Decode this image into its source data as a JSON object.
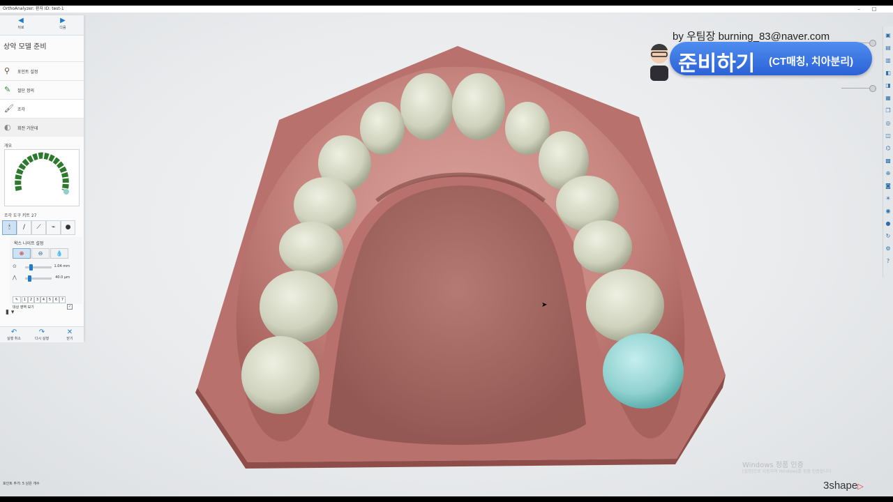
{
  "window": {
    "title": "OrthoAnalyzer: 환자 ID: test-1",
    "minimize": "–",
    "maximize": "□"
  },
  "nav": {
    "prev_label": "뒤로",
    "next_label": "다음"
  },
  "panel": {
    "section_title": "상악 모델 준비",
    "steps": [
      {
        "label": "포인트 설정"
      },
      {
        "label": "절단 정의"
      },
      {
        "label": "조각"
      },
      {
        "label": "회전 가운데"
      }
    ],
    "overview_title": "개요",
    "kit_title": "조각 도구 키트 27",
    "wax_title": "왁스 나이프 설정",
    "wax_size_value": "1.04 mm",
    "wax_angle_value": "40.0 μm",
    "numbers": [
      "1",
      "2",
      "3",
      "4",
      "5",
      "6",
      "7"
    ],
    "show_target_label": "대상 영역 보기",
    "show_target_checked": "✓"
  },
  "bottom": {
    "undo": "실행 취소",
    "redo": "다시 실행",
    "close": "닫기"
  },
  "overlay": {
    "byline": "by 우팀장 burning_83@naver.com",
    "main": "준비하기",
    "sub": "(CT매칭, 치아분리)"
  },
  "watermark": {
    "line1": "Windows 정품 인증",
    "line2": "[설정]으로 이동하여 Windows를 정품 인증합니다."
  },
  "logo": "3shape",
  "status": "포인트 추가: 5 남은 개수",
  "colors": {
    "gum": "#c88680",
    "tooth": "#d3d5c2",
    "selected_tooth": "#8fd1cf",
    "accent": "#1f7ccc"
  }
}
